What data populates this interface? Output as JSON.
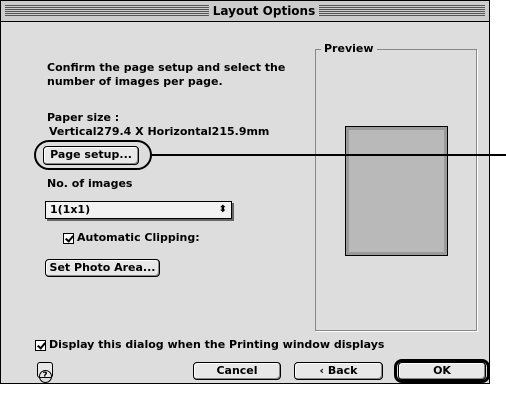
{
  "window": {
    "title": "Layout Options"
  },
  "instructions": {
    "line1": "Confirm the page setup and select the",
    "line2": "number of images per page."
  },
  "paper_size": {
    "label": "Paper size :",
    "value": "Vertical279.4 X Horizontal215.9mm"
  },
  "buttons": {
    "page_setup": "Page setup...",
    "set_photo_area": "Set Photo Area...",
    "cancel": "Cancel",
    "back": "‹ Back",
    "ok": "OK"
  },
  "images": {
    "label": "No. of images",
    "selected": "1(1x1)"
  },
  "auto_clipping": {
    "label": "Automatic Clipping:",
    "checked": true
  },
  "preview": {
    "label": "Preview"
  },
  "display_dialog": {
    "label": "Display this dialog when the Printing window displays",
    "checked": true
  },
  "help": {
    "glyph": "?"
  },
  "icons": {
    "select_arrows": "updown-arrows-icon",
    "help": "help-icon"
  },
  "colors": {
    "window_bg": "#dddddd",
    "paper_border": "#9a9a9a",
    "paper_fill": "#b9b9b9"
  }
}
